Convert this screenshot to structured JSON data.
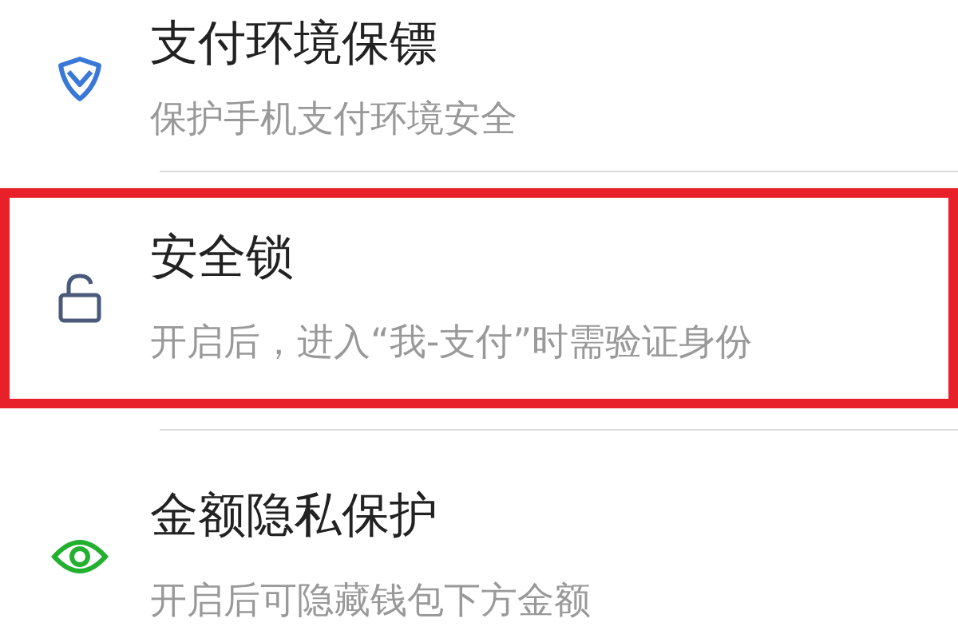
{
  "settings": [
    {
      "kind": "shield",
      "title": "支付环境保镖",
      "subtitle": "保护手机支付环境安全",
      "highlighted": false
    },
    {
      "kind": "lock",
      "title": "安全锁",
      "subtitle": "开启后，进入“我-支付”时需验证身份",
      "highlighted": true
    },
    {
      "kind": "eye",
      "title": "金额隐私保护",
      "subtitle": "开启后可隐藏钱包下方金额",
      "highlighted": false
    }
  ]
}
